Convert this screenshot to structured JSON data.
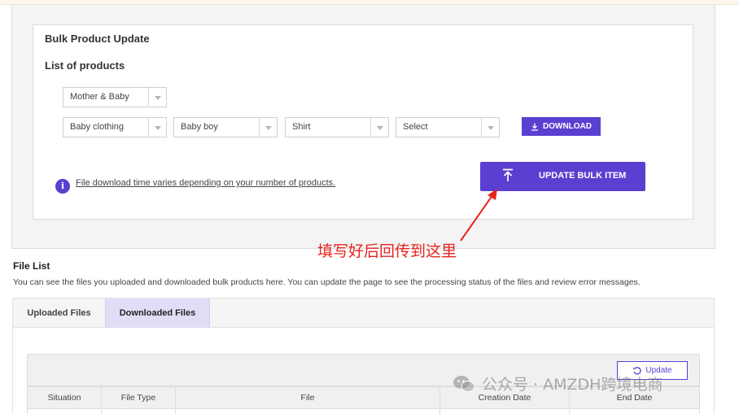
{
  "card": {
    "title": "Bulk Product Update",
    "subtitle": "List of products"
  },
  "selects": {
    "category1": "Mother & Baby",
    "category2": "Baby clothing",
    "category3": "Baby boy",
    "category4": "Shirt",
    "category5": "Select"
  },
  "buttons": {
    "download_label": "DOWNLOAD",
    "update_bulk_label": "UPDATE BULK ITEM",
    "update_label": "Update"
  },
  "info": {
    "text": "File download time varies depending on your number of products."
  },
  "annotation": {
    "text": "填写好后回传到这里"
  },
  "file_list": {
    "title": "File List",
    "description": "You can see the files you uploaded and downloaded bulk products here. You can update the page to see the processing status of the files and review error messages.",
    "tabs": [
      {
        "label": "Uploaded Files",
        "active": false
      },
      {
        "label": "Downloaded Files",
        "active": true
      }
    ],
    "columns": [
      "Situation",
      "File Type",
      "File",
      "Creation Date",
      "End Date"
    ]
  },
  "watermark": {
    "text": "公众号 · AMZDH跨境电商"
  },
  "colors": {
    "accent": "#5b3fd1",
    "annotation": "#e8231e",
    "active_tab": "#e3dcf7"
  },
  "icons": {
    "download": "download-icon",
    "upload": "upload-arrow-icon",
    "info": "info-icon",
    "refresh": "refresh-icon",
    "wechat": "wechat-icon"
  }
}
